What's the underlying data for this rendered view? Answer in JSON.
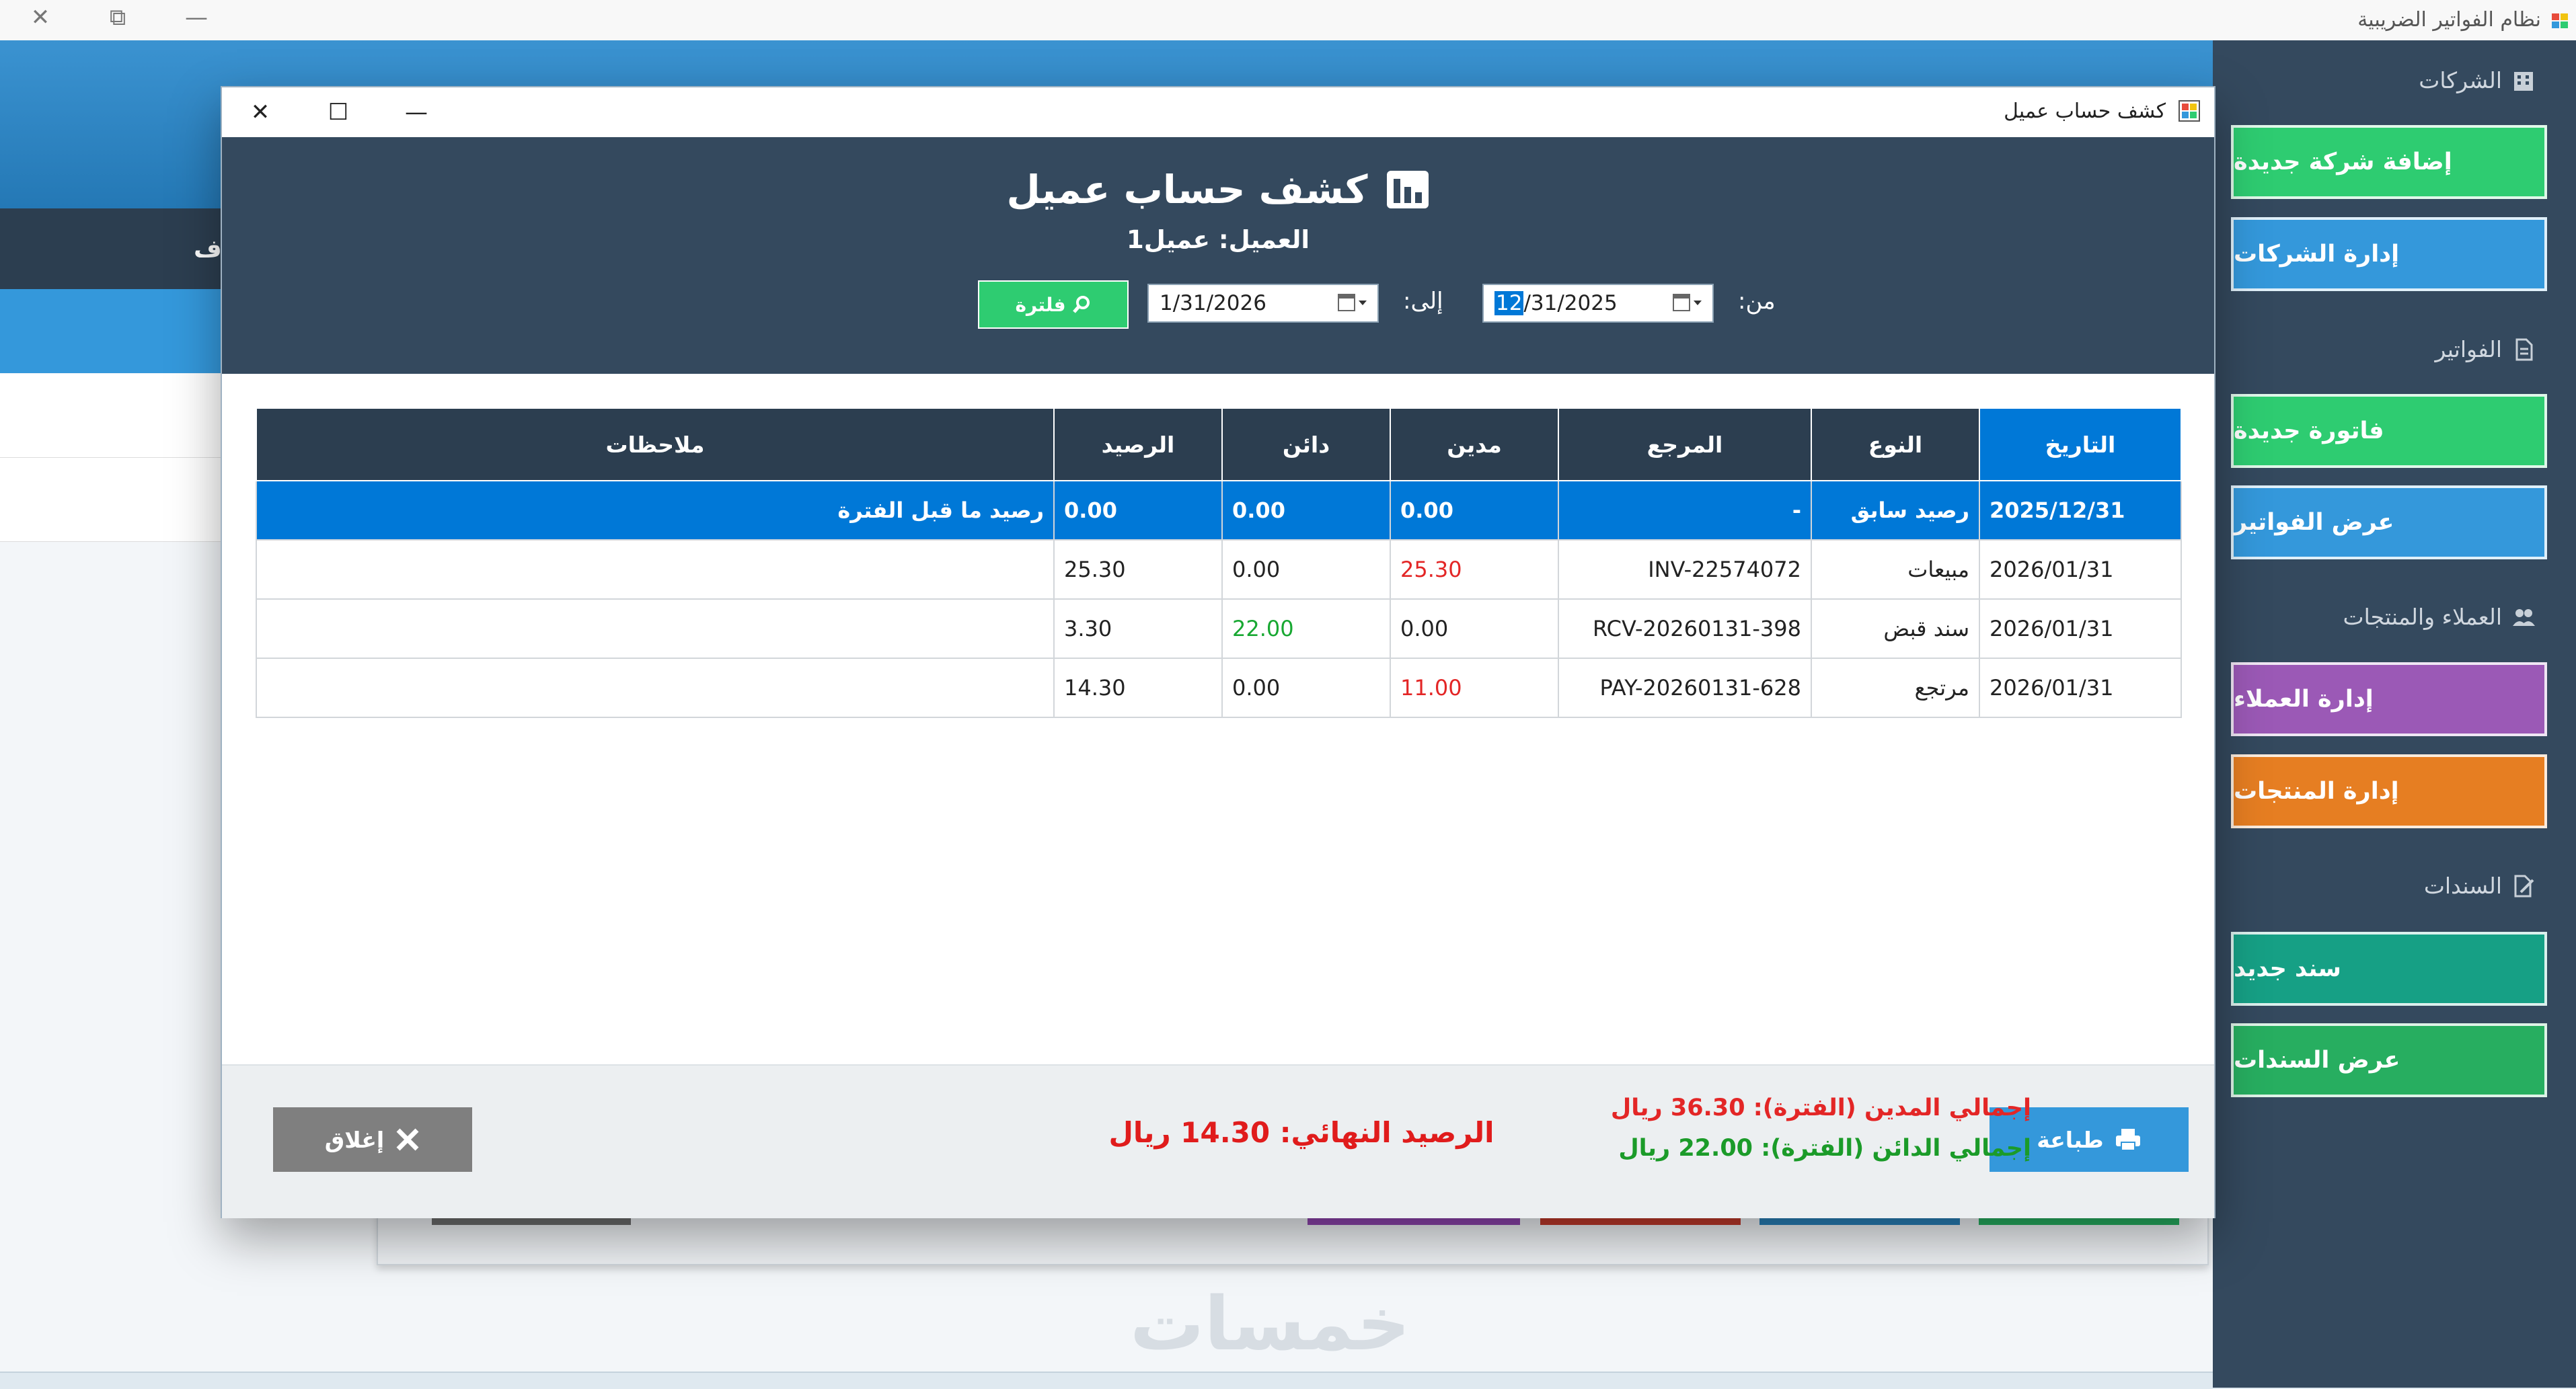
{
  "app": {
    "title": "نظام الفواتير الضريبية",
    "controls": {
      "close": "✕",
      "restore": "⧉",
      "minimize": "—"
    }
  },
  "sidebar": {
    "sections": [
      {
        "title": "الشركات",
        "icon": "building-icon"
      },
      {
        "title": "الفواتير",
        "icon": "document-icon"
      },
      {
        "title": "العملاء والمنتجات",
        "icon": "users-icon"
      },
      {
        "title": "السندات",
        "icon": "edit-document-icon"
      }
    ],
    "buttons": [
      {
        "label": "إضافة شركة جديدة",
        "color": "#2ecc71"
      },
      {
        "label": "إدارة الشركات",
        "color": "#3498db"
      },
      {
        "label": "فاتورة جديدة",
        "color": "#2ecc71"
      },
      {
        "label": "عرض الفواتير",
        "color": "#3498db"
      },
      {
        "label": "إدارة العملاء",
        "color": "#9b59b6"
      },
      {
        "label": "إدارة المنتجات",
        "color": "#e67e22"
      },
      {
        "label": "سند جديد",
        "color": "#16a085"
      },
      {
        "label": "عرض السندات",
        "color": "#27ae60"
      }
    ]
  },
  "background": {
    "darkbar_text": "ف",
    "watermark": "خمسات"
  },
  "dialog": {
    "window_title": "كشف حساب عميل",
    "controls": {
      "close": "✕",
      "maximize": "☐",
      "minimize": "—"
    },
    "heading": "كشف حساب عميل",
    "customer_line": "العميل: عميل1",
    "filters": {
      "from_label": "من:",
      "from_value_selected": "12",
      "from_value_rest": "/31/2025",
      "to_label": "إلى:",
      "to_value": "1/31/2026",
      "filter_button": "فلترة"
    },
    "table": {
      "columns": [
        "التاريخ",
        "النوع",
        "المرجع",
        "مدين",
        "دائن",
        "الرصيد",
        "ملاحظات"
      ],
      "rows": [
        {
          "date": "2025/12/31",
          "type": "رصيد سابق",
          "ref": "-",
          "debit": "0.00",
          "credit": "0.00",
          "balance": "0.00",
          "notes": "رصيد ما قبل الفترة"
        },
        {
          "date": "2026/01/31",
          "type": "مبيعات",
          "ref": "INV-22574072",
          "debit": "25.30",
          "credit": "0.00",
          "balance": "25.30",
          "notes": ""
        },
        {
          "date": "2026/01/31",
          "type": "سند قبض",
          "ref": "RCV-20260131-398",
          "debit": "0.00",
          "credit": "22.00",
          "balance": "3.30",
          "notes": ""
        },
        {
          "date": "2026/01/31",
          "type": "مرتجع",
          "ref": "PAY-20260131-628",
          "debit": "11.00",
          "credit": "0.00",
          "balance": "14.30",
          "notes": ""
        }
      ]
    },
    "footer": {
      "print_button": "طباعة",
      "close_button": "إغلاق",
      "total_debit": "إجمالي المدين (الفترة): 36.30 ريال",
      "total_credit": "إجمالي الدائن (الفترة): 22.00 ريال",
      "final_balance": "الرصيد النهائي: 14.30 ريال"
    }
  },
  "colors": {
    "header_dark": "#34495e",
    "selection_blue": "#0078d7",
    "debit_red": "#e32626",
    "credit_green": "#18a832"
  }
}
